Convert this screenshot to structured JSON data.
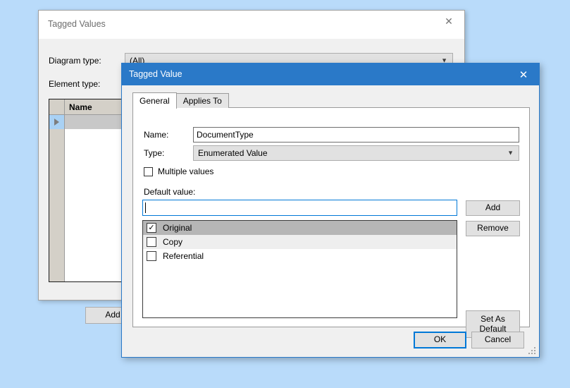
{
  "desktop": {
    "background_color": "#b9dbfa"
  },
  "tagged_values_dialog": {
    "title": "Tagged Values",
    "close_icon": "close-icon",
    "fields": {
      "diagram_type_label": "Diagram type:",
      "diagram_type_value": "(All)",
      "element_type_label": "Element type:"
    },
    "grid": {
      "column_header": "Name",
      "row_indicator_icon": "row-selector-arrow-icon",
      "rows": [
        ""
      ]
    },
    "buttons": {
      "add_label": "Add",
      "second_label": ""
    }
  },
  "tagged_value_dialog": {
    "title": "Tagged Value",
    "close_icon": "close-icon",
    "accent_color": "#2a79c8",
    "focus_color": "#0078d7",
    "tabs": [
      {
        "label": "General",
        "active": true
      },
      {
        "label": "Applies To",
        "active": false
      }
    ],
    "general": {
      "name_label": "Name:",
      "name_value": "DocumentType",
      "type_label": "Type:",
      "type_value": "Enumerated Value",
      "type_dropdown_icon": "chevron-down-icon",
      "multiple_values_label": "Multiple values",
      "multiple_values_checked": false,
      "default_value_label": "Default value:",
      "default_value_input": "",
      "default_value_placeholder": "",
      "values_list": [
        {
          "label": "Original",
          "checked": true,
          "selected": true
        },
        {
          "label": "Copy",
          "checked": false,
          "selected": false
        },
        {
          "label": "Referential",
          "checked": false,
          "selected": false
        }
      ],
      "check_glyph": "✓",
      "add_label": "Add",
      "remove_label": "Remove",
      "set_as_default_line1": "Set As",
      "set_as_default_line2": "Default"
    },
    "footer": {
      "ok_label": "OK",
      "cancel_label": "Cancel"
    },
    "resize_grip_icon": "resize-grip-icon"
  }
}
